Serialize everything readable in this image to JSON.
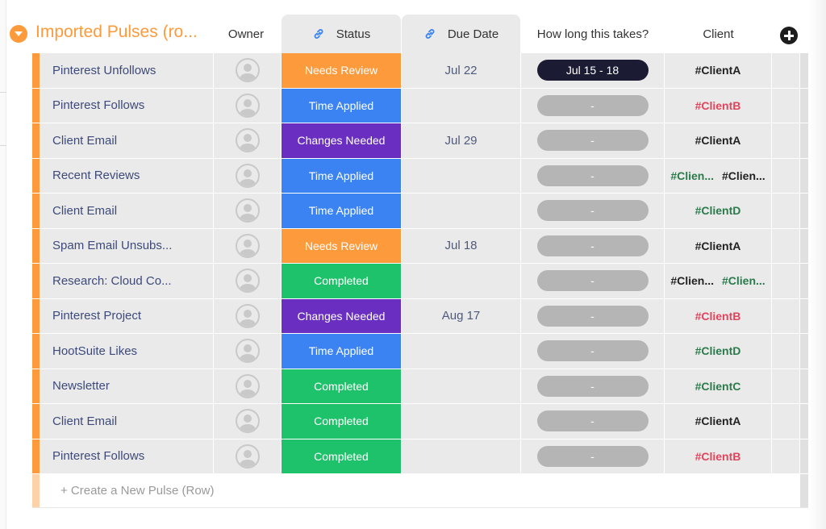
{
  "group": {
    "title": "Imported Pulses (ro...",
    "color": "#fd9a3b"
  },
  "columns": {
    "owner": "Owner",
    "status": "Status",
    "due_date": "Due Date",
    "duration": "How long this takes?",
    "client": "Client"
  },
  "status_colors": {
    "Needs Review": "#fd9a3b",
    "Time Applied": "#3b83f3",
    "Changes Needed": "#6a2fc0",
    "Completed": "#1dc26a"
  },
  "client_colors": {
    "dark": "#222222",
    "red": "#e2445c",
    "green": "#2a7a4b"
  },
  "rows": [
    {
      "name": "Pinterest Unfollows",
      "status": "Needs Review",
      "due": "Jul 22",
      "timeline": "Jul 15 - 18",
      "timeline_set": true,
      "clients": [
        {
          "text": "#ClientA",
          "color": "dark"
        }
      ]
    },
    {
      "name": "Pinterest Follows",
      "status": "Time Applied",
      "due": "",
      "timeline": "-",
      "timeline_set": false,
      "clients": [
        {
          "text": "#ClientB",
          "color": "red"
        }
      ]
    },
    {
      "name": "Client Email",
      "status": "Changes Needed",
      "due": "Jul 29",
      "timeline": "-",
      "timeline_set": false,
      "clients": [
        {
          "text": "#ClientA",
          "color": "dark"
        }
      ]
    },
    {
      "name": "Recent Reviews",
      "status": "Time Applied",
      "due": "",
      "timeline": "-",
      "timeline_set": false,
      "clients": [
        {
          "text": "#Clien...",
          "color": "green"
        },
        {
          "text": "#Clien...",
          "color": "dark"
        }
      ]
    },
    {
      "name": "Client Email",
      "status": "Time Applied",
      "due": "",
      "timeline": "-",
      "timeline_set": false,
      "clients": [
        {
          "text": "#ClientD",
          "color": "green"
        }
      ]
    },
    {
      "name": "Spam Email Unsubs...",
      "status": "Needs Review",
      "due": "Jul 18",
      "timeline": "-",
      "timeline_set": false,
      "clients": [
        {
          "text": "#ClientA",
          "color": "dark"
        }
      ]
    },
    {
      "name": "Research: Cloud Co...",
      "status": "Completed",
      "due": "",
      "timeline": "-",
      "timeline_set": false,
      "clients": [
        {
          "text": "#Clien...",
          "color": "dark"
        },
        {
          "text": "#Clien...",
          "color": "green"
        }
      ]
    },
    {
      "name": "Pinterest Project",
      "status": "Changes Needed",
      "due": "Aug 17",
      "timeline": "-",
      "timeline_set": false,
      "clients": [
        {
          "text": "#ClientB",
          "color": "red"
        }
      ]
    },
    {
      "name": "HootSuite Likes",
      "status": "Time Applied",
      "due": "",
      "timeline": "-",
      "timeline_set": false,
      "clients": [
        {
          "text": "#ClientD",
          "color": "green"
        }
      ]
    },
    {
      "name": "Newsletter",
      "status": "Completed",
      "due": "",
      "timeline": "-",
      "timeline_set": false,
      "clients": [
        {
          "text": "#ClientC",
          "color": "green"
        }
      ]
    },
    {
      "name": "Client Email",
      "status": "Completed",
      "due": "",
      "timeline": "-",
      "timeline_set": false,
      "clients": [
        {
          "text": "#ClientA",
          "color": "dark"
        }
      ]
    },
    {
      "name": "Pinterest Follows",
      "status": "Completed",
      "due": "",
      "timeline": "-",
      "timeline_set": false,
      "clients": [
        {
          "text": "#ClientB",
          "color": "red"
        }
      ]
    }
  ],
  "new_row_label": "+ Create a New Pulse (Row)"
}
